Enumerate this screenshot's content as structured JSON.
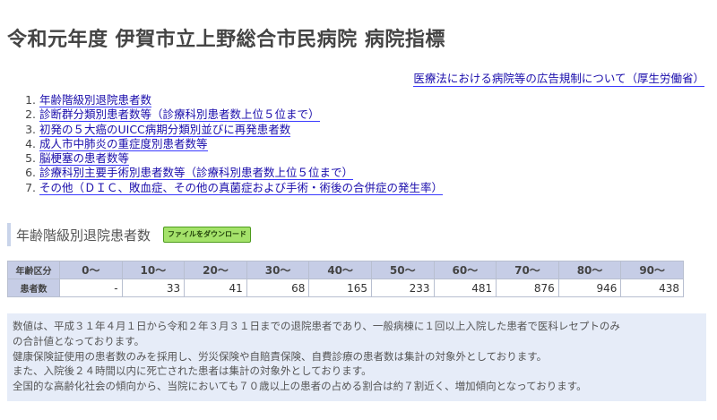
{
  "page": {
    "title": "令和元年度 伊賀市立上野総合市民病院 病院指標",
    "ad_rule_link": "医療法における病院等の広告規制について（厚生労働省）"
  },
  "toc": [
    {
      "num": "1.",
      "label": "年齢階級別退院患者数"
    },
    {
      "num": "2.",
      "label": "診断群分類別患者数等（診療科別患者数上位５位まで）"
    },
    {
      "num": "3.",
      "label": "初発の５大癌のUICC病期分類別並びに再発患者数"
    },
    {
      "num": "4.",
      "label": "成人市中肺炎の重症度別患者数等"
    },
    {
      "num": "5.",
      "label": "脳梗塞の患者数等"
    },
    {
      "num": "6.",
      "label": "診療科別主要手術別患者数等（診療科別患者数上位５位まで）"
    },
    {
      "num": "7.",
      "label": "その他（ＤＩＣ、敗血症、その他の真菌症および手術・術後の合併症の発生率）"
    }
  ],
  "section": {
    "title": "年齢階級別退院患者数",
    "download_label": "ファイルをダウンロード"
  },
  "table": {
    "header_label": "年齢区分",
    "row_label": "患者数",
    "columns": [
      "0〜",
      "10〜",
      "20〜",
      "30〜",
      "40〜",
      "50〜",
      "60〜",
      "70〜",
      "80〜",
      "90〜"
    ],
    "values": [
      "-",
      "33",
      "41",
      "68",
      "165",
      "233",
      "481",
      "876",
      "946",
      "438"
    ]
  },
  "notes": [
    "数値は、平成３１年４月１日から令和２年３月３１日までの退院患者であり、一般病棟に１回以上入院した患者で医科レセプトのみ",
    "の合計値となっております。",
    "健康保険証使用の患者数のみを採用し、労災保険や自賠責保険、自費診療の患者数は集計の対象外としております。",
    "また、入院後２４時間以内に死亡された患者は集計の対象外としております。",
    "全国的な高齢化社会の傾向から、当院においても７０歳以上の患者の占める割合は約７割近く、増加傾向となっております。"
  ]
}
